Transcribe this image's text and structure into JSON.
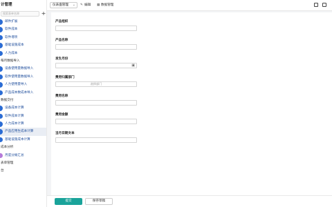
{
  "sidebar": {
    "title": "计管理",
    "search_placeholder": "搜索表单名称",
    "items": [
      {
        "type": "item",
        "label": "邮件扩展"
      },
      {
        "type": "item",
        "label": "软件成本"
      },
      {
        "type": "item",
        "label": "软件增项"
      },
      {
        "type": "item",
        "label": "基础设施成本"
      },
      {
        "type": "item",
        "label": "人力成本"
      },
      {
        "type": "group",
        "label": "每月数据导入"
      },
      {
        "type": "item",
        "label": "设备使用量数据导入"
      },
      {
        "type": "item",
        "label": "软件使用量数据导入"
      },
      {
        "type": "item",
        "label": "人力使用量导入"
      },
      {
        "type": "item",
        "label": "产品成本数成本导入"
      },
      {
        "type": "group",
        "label": "数据交付"
      },
      {
        "type": "item",
        "label": "设备成本计算"
      },
      {
        "type": "item",
        "label": "软件成本计算"
      },
      {
        "type": "item",
        "label": "人力成本计算"
      },
      {
        "type": "item",
        "label": "产品应用生成本计算",
        "active": true
      },
      {
        "type": "item",
        "label": "基础设施成本计算"
      },
      {
        "type": "group",
        "label": "成本分析"
      },
      {
        "type": "item",
        "label": "月度分摊汇总",
        "purple": true
      },
      {
        "type": "group",
        "label": "表单管理"
      },
      {
        "type": "group",
        "label": "台"
      }
    ]
  },
  "topbar": {
    "app_selector": "仪表盘管理",
    "edit_label": "编辑",
    "data_manage_label": "数据管理"
  },
  "form": {
    "fields": [
      {
        "label": "产品组织",
        "kind": "text",
        "value": ""
      },
      {
        "label": "产品名称",
        "kind": "text",
        "value": ""
      },
      {
        "label": "发生月份",
        "kind": "date",
        "value": ""
      },
      {
        "label": "费用归属部门",
        "kind": "select",
        "placeholder": "选择部门"
      },
      {
        "label": "费用名称",
        "kind": "text",
        "value": ""
      },
      {
        "label": "费用金额",
        "kind": "text",
        "value": ""
      },
      {
        "label": "当月日期文本",
        "kind": "text",
        "value": ""
      }
    ]
  },
  "actions": {
    "submit_label": "提交",
    "save_draft_label": "保存草稿"
  },
  "colors": {
    "accent": "#1aa39a",
    "sidebar_dot": "#2b6cd4",
    "sidebar_text": "#1f4e9c"
  }
}
